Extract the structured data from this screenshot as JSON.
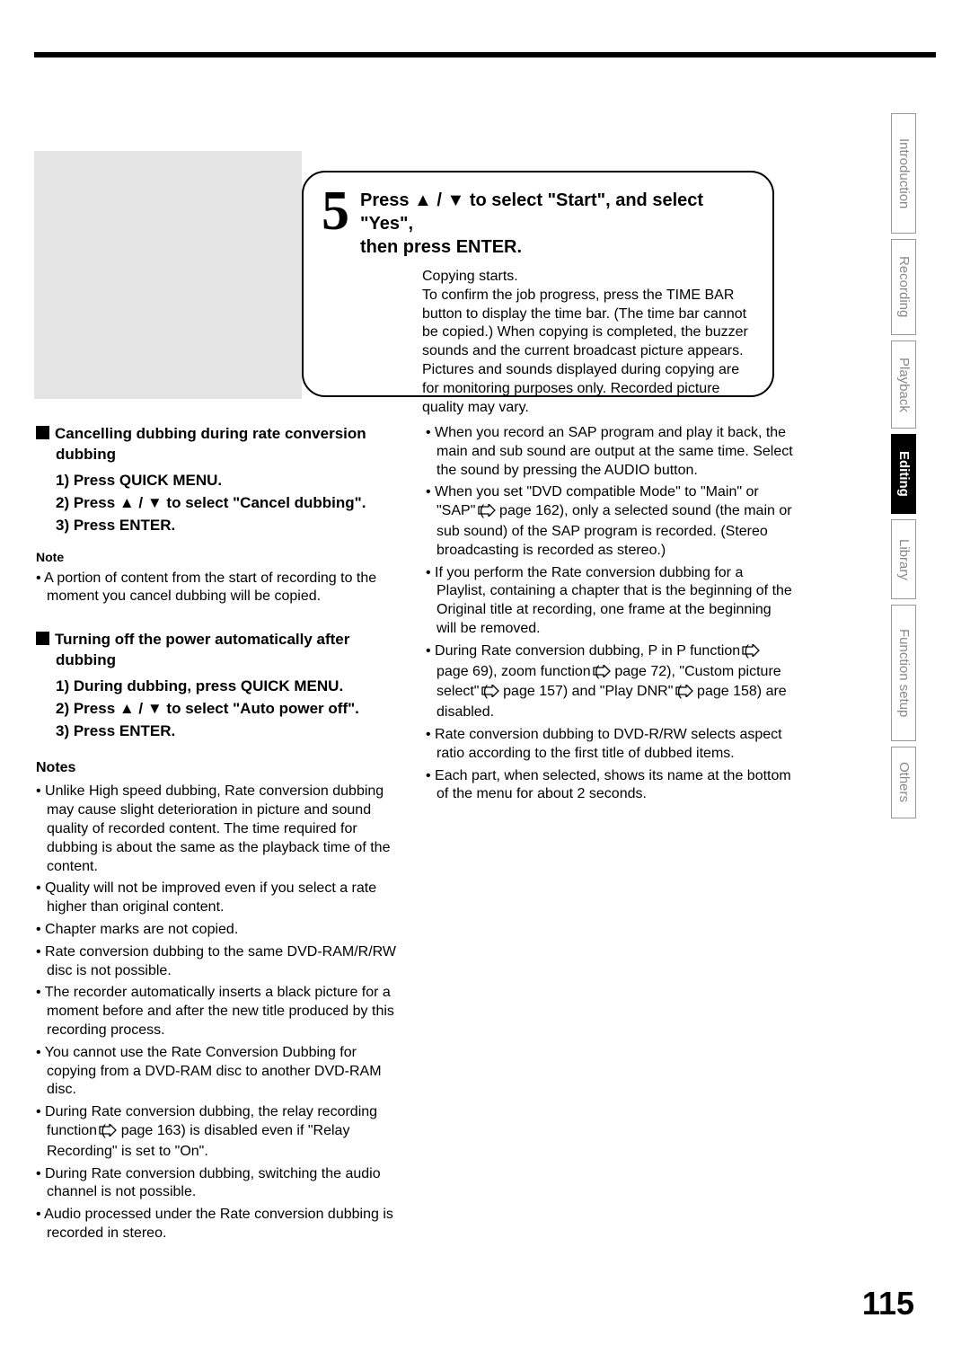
{
  "page_number": "115",
  "step": {
    "num": "5",
    "title_a": "Press ▲ / ▼ to select \"Start\", and select \"Yes\",",
    "title_b": "then press ENTER.",
    "body": "Copying starts.\nTo confirm the job progress, press the TIME BAR button to display the time bar. (The time bar cannot be copied.) When copying is completed, the buzzer sounds and the current broadcast picture appears.\nPictures and sounds displayed during copying are for monitoring purposes only. Recorded picture quality may vary."
  },
  "left": {
    "s1_h": "Cancelling dubbing during rate conversion dubbing",
    "s1_1": "1) Press QUICK MENU.",
    "s1_2": "2) Press ▲ / ▼ to select \"Cancel dubbing\".",
    "s1_3": "3) Press ENTER.",
    "s1_notelbl": "Note",
    "s1_note": "A portion of content from the start of recording to the moment you cancel dubbing will be copied.",
    "s2_h": "Turning off the power automatically after dubbing",
    "s2_1": "1) During dubbing, press QUICK MENU.",
    "s2_2": "2) Press ▲ / ▼ to select \"Auto power off\".",
    "s2_3": "3) Press ENTER.",
    "noteslbl": "Notes",
    "n1": "Unlike High speed dubbing, Rate conversion dubbing may cause slight deterioration in picture and sound quality of recorded content. The time required for dubbing is about the same as the playback time of the content.",
    "n2": "Quality will not be improved even if you select a rate higher than original content.",
    "n3": "Chapter marks are not copied.",
    "n4": "Rate conversion dubbing to the same DVD-RAM/R/RW disc is not possible.",
    "n5": "The recorder automatically inserts a black picture for a moment before and after the new title produced by this recording process.",
    "n6": "You cannot use the Rate Conversion Dubbing for copying from a DVD-RAM disc to another DVD-RAM disc.",
    "n7a": "During Rate conversion dubbing, the relay recording function ( ",
    "n7b": " page 163) is disabled even if \"Relay Recording\" is set to \"On\".",
    "n8": "During Rate conversion dubbing, switching the audio channel is not possible.",
    "n9": "Audio processed under the Rate conversion dubbing is recorded in stereo."
  },
  "right": {
    "r1": "When you record an SAP program and play it back, the main and sub sound are output at the same time. Select the sound by pressing the AUDIO button.",
    "r2a": "When you set \"DVD compatible Mode\" to \"Main\" or \"SAP\" ( ",
    "r2b": " page 162), only a selected sound (the main or sub sound) of the SAP program is recorded. (Stereo broadcasting is recorded as stereo.)",
    "r3": "If you perform the Rate conversion dubbing for a Playlist, containing a chapter that is the beginning of the Original title at recording, one frame at the beginning will be removed.",
    "r4a": "During Rate conversion dubbing, P in P function ( ",
    "r4b": " page 69), zoom function ( ",
    "r4c": " page 72), \"Custom picture select\" ( ",
    "r4d": " page 157) and \"Play DNR\" ( ",
    "r4e": " page 158) are disabled.",
    "r5": "Rate conversion dubbing to DVD-R/RW selects aspect ratio according to the first title of dubbed items.",
    "r6": "Each part, when selected, shows its name at the bottom of the menu for about 2 seconds."
  },
  "tabs": [
    "Introduction",
    "Recording",
    "Playback",
    "Editing",
    "Library",
    "Function setup",
    "Others"
  ],
  "active_tab": 3
}
